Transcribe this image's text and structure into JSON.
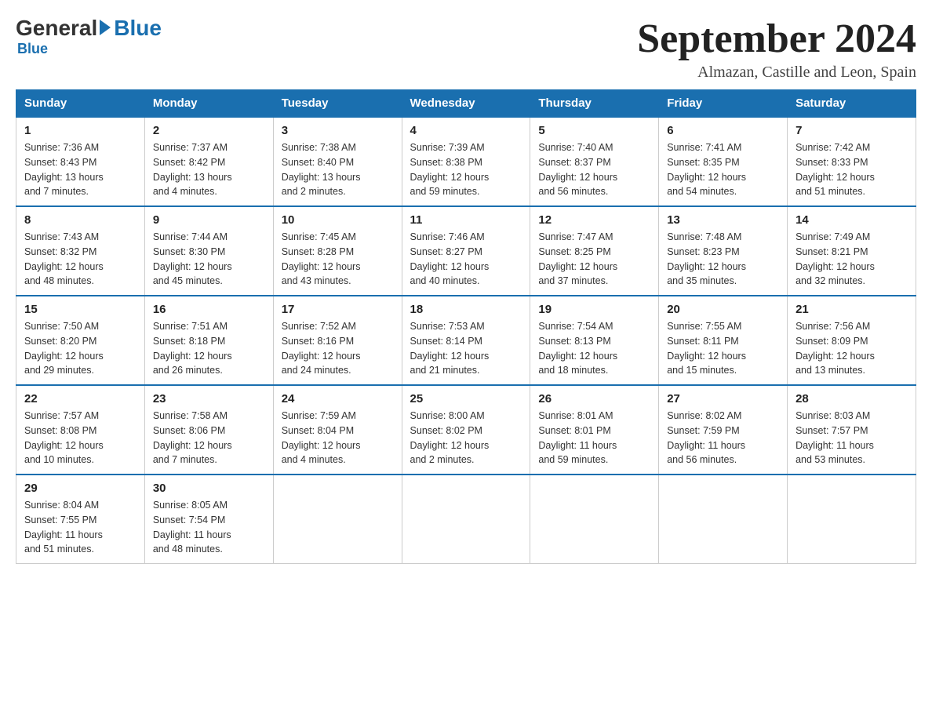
{
  "logo": {
    "general": "General",
    "blue": "Blue"
  },
  "title": "September 2024",
  "location": "Almazan, Castille and Leon, Spain",
  "days_of_week": [
    "Sunday",
    "Monday",
    "Tuesday",
    "Wednesday",
    "Thursday",
    "Friday",
    "Saturday"
  ],
  "weeks": [
    [
      {
        "day": "1",
        "sunrise": "7:36 AM",
        "sunset": "8:43 PM",
        "daylight": "13 hours and 7 minutes."
      },
      {
        "day": "2",
        "sunrise": "7:37 AM",
        "sunset": "8:42 PM",
        "daylight": "13 hours and 4 minutes."
      },
      {
        "day": "3",
        "sunrise": "7:38 AM",
        "sunset": "8:40 PM",
        "daylight": "13 hours and 2 minutes."
      },
      {
        "day": "4",
        "sunrise": "7:39 AM",
        "sunset": "8:38 PM",
        "daylight": "12 hours and 59 minutes."
      },
      {
        "day": "5",
        "sunrise": "7:40 AM",
        "sunset": "8:37 PM",
        "daylight": "12 hours and 56 minutes."
      },
      {
        "day": "6",
        "sunrise": "7:41 AM",
        "sunset": "8:35 PM",
        "daylight": "12 hours and 54 minutes."
      },
      {
        "day": "7",
        "sunrise": "7:42 AM",
        "sunset": "8:33 PM",
        "daylight": "12 hours and 51 minutes."
      }
    ],
    [
      {
        "day": "8",
        "sunrise": "7:43 AM",
        "sunset": "8:32 PM",
        "daylight": "12 hours and 48 minutes."
      },
      {
        "day": "9",
        "sunrise": "7:44 AM",
        "sunset": "8:30 PM",
        "daylight": "12 hours and 45 minutes."
      },
      {
        "day": "10",
        "sunrise": "7:45 AM",
        "sunset": "8:28 PM",
        "daylight": "12 hours and 43 minutes."
      },
      {
        "day": "11",
        "sunrise": "7:46 AM",
        "sunset": "8:27 PM",
        "daylight": "12 hours and 40 minutes."
      },
      {
        "day": "12",
        "sunrise": "7:47 AM",
        "sunset": "8:25 PM",
        "daylight": "12 hours and 37 minutes."
      },
      {
        "day": "13",
        "sunrise": "7:48 AM",
        "sunset": "8:23 PM",
        "daylight": "12 hours and 35 minutes."
      },
      {
        "day": "14",
        "sunrise": "7:49 AM",
        "sunset": "8:21 PM",
        "daylight": "12 hours and 32 minutes."
      }
    ],
    [
      {
        "day": "15",
        "sunrise": "7:50 AM",
        "sunset": "8:20 PM",
        "daylight": "12 hours and 29 minutes."
      },
      {
        "day": "16",
        "sunrise": "7:51 AM",
        "sunset": "8:18 PM",
        "daylight": "12 hours and 26 minutes."
      },
      {
        "day": "17",
        "sunrise": "7:52 AM",
        "sunset": "8:16 PM",
        "daylight": "12 hours and 24 minutes."
      },
      {
        "day": "18",
        "sunrise": "7:53 AM",
        "sunset": "8:14 PM",
        "daylight": "12 hours and 21 minutes."
      },
      {
        "day": "19",
        "sunrise": "7:54 AM",
        "sunset": "8:13 PM",
        "daylight": "12 hours and 18 minutes."
      },
      {
        "day": "20",
        "sunrise": "7:55 AM",
        "sunset": "8:11 PM",
        "daylight": "12 hours and 15 minutes."
      },
      {
        "day": "21",
        "sunrise": "7:56 AM",
        "sunset": "8:09 PM",
        "daylight": "12 hours and 13 minutes."
      }
    ],
    [
      {
        "day": "22",
        "sunrise": "7:57 AM",
        "sunset": "8:08 PM",
        "daylight": "12 hours and 10 minutes."
      },
      {
        "day": "23",
        "sunrise": "7:58 AM",
        "sunset": "8:06 PM",
        "daylight": "12 hours and 7 minutes."
      },
      {
        "day": "24",
        "sunrise": "7:59 AM",
        "sunset": "8:04 PM",
        "daylight": "12 hours and 4 minutes."
      },
      {
        "day": "25",
        "sunrise": "8:00 AM",
        "sunset": "8:02 PM",
        "daylight": "12 hours and 2 minutes."
      },
      {
        "day": "26",
        "sunrise": "8:01 AM",
        "sunset": "8:01 PM",
        "daylight": "11 hours and 59 minutes."
      },
      {
        "day": "27",
        "sunrise": "8:02 AM",
        "sunset": "7:59 PM",
        "daylight": "11 hours and 56 minutes."
      },
      {
        "day": "28",
        "sunrise": "8:03 AM",
        "sunset": "7:57 PM",
        "daylight": "11 hours and 53 minutes."
      }
    ],
    [
      {
        "day": "29",
        "sunrise": "8:04 AM",
        "sunset": "7:55 PM",
        "daylight": "11 hours and 51 minutes."
      },
      {
        "day": "30",
        "sunrise": "8:05 AM",
        "sunset": "7:54 PM",
        "daylight": "11 hours and 48 minutes."
      },
      null,
      null,
      null,
      null,
      null
    ]
  ],
  "labels": {
    "sunrise": "Sunrise:",
    "sunset": "Sunset:",
    "daylight": "Daylight:"
  }
}
